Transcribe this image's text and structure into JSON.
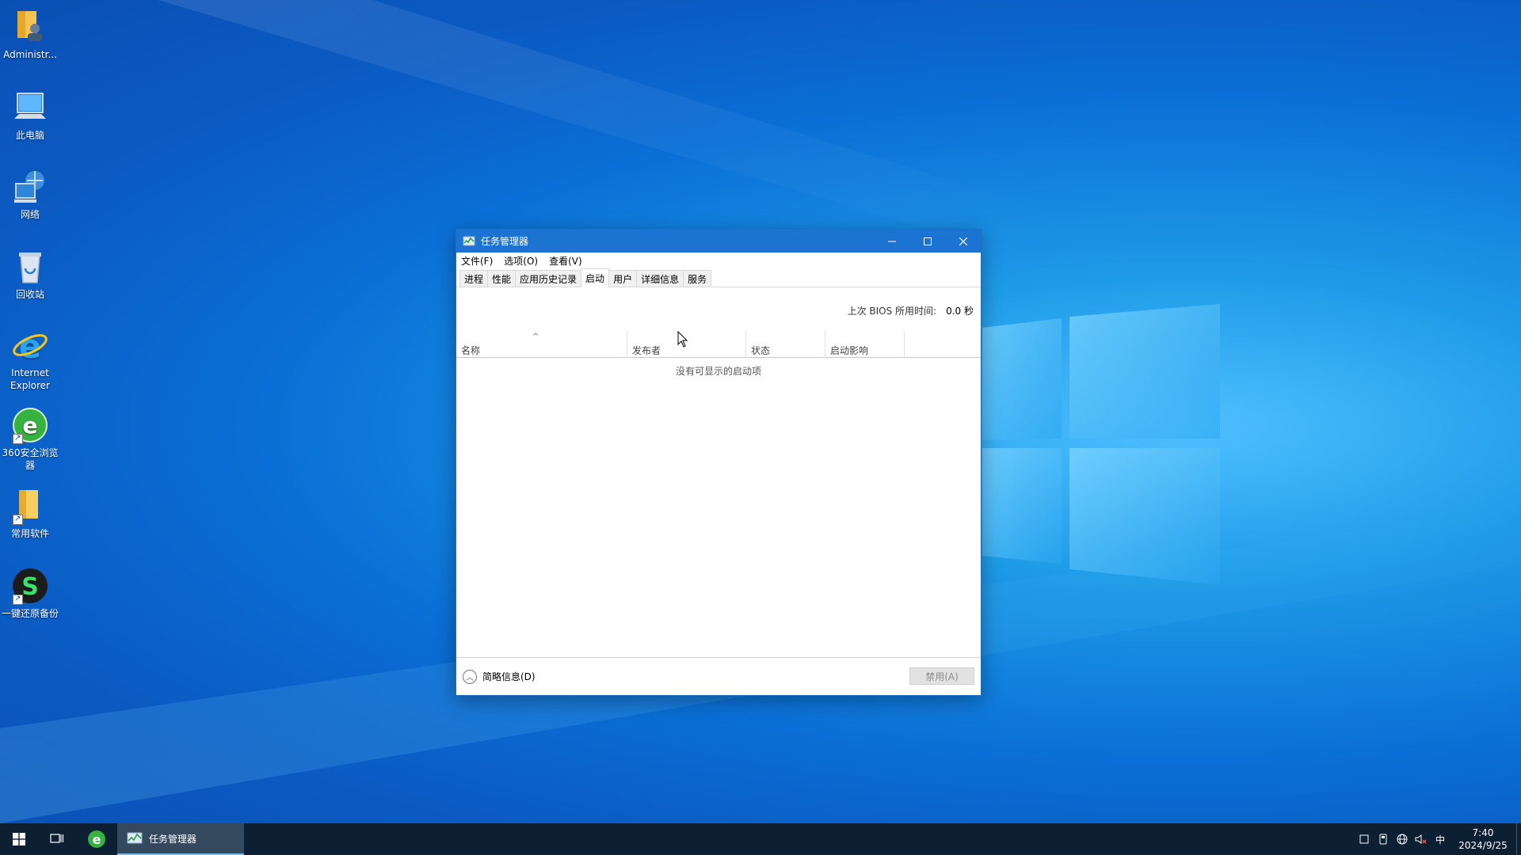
{
  "desktop": {
    "icons": [
      {
        "label": "Administr..."
      },
      {
        "label": "此电脑"
      },
      {
        "label": "网络"
      },
      {
        "label": "回收站"
      },
      {
        "label": "Internet Explorer"
      },
      {
        "label": "360安全浏览器"
      },
      {
        "label": "常用软件"
      },
      {
        "label": "一键还原备份"
      }
    ]
  },
  "window": {
    "title": "任务管理器",
    "menu": [
      "文件(F)",
      "选项(O)",
      "查看(V)"
    ],
    "tabs": [
      {
        "label": "进程",
        "active": false
      },
      {
        "label": "性能",
        "active": false
      },
      {
        "label": "应用历史记录",
        "active": false
      },
      {
        "label": "启动",
        "active": true
      },
      {
        "label": "用户",
        "active": false
      },
      {
        "label": "详细信息",
        "active": false
      },
      {
        "label": "服务",
        "active": false
      }
    ],
    "bios_label": "上次 BIOS 所用时间:",
    "bios_value": "0.0 秒",
    "columns": [
      "名称",
      "发布者",
      "状态",
      "启动影响"
    ],
    "empty_text": "没有可显示的启动项",
    "footer": {
      "toggle_label": "简略信息(D)",
      "disable_label": "禁用(A)"
    }
  },
  "taskbar": {
    "active_app": "任务管理器",
    "ime": "中",
    "time": "7:40",
    "date": "2024/9/25"
  },
  "colors": {
    "titlebar": "#1c74d2",
    "taskbar": "#0d1f33",
    "desktop_accent": "#0a6fd6"
  }
}
